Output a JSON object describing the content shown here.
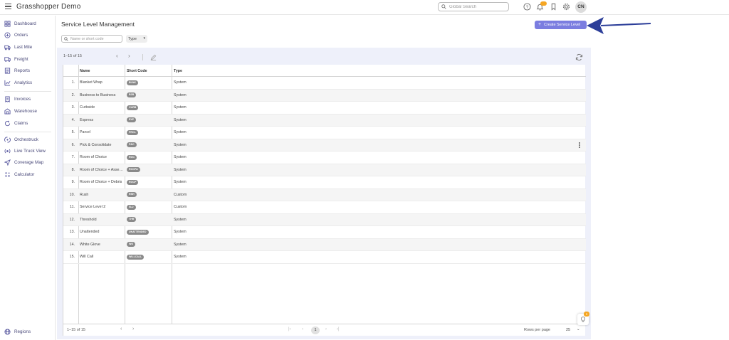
{
  "app": {
    "title": "Grasshopper Demo",
    "search_placeholder": "Global Search",
    "notification_count": "",
    "user_initials": "CN"
  },
  "sidebar": {
    "items": [
      {
        "label": "Dashboard",
        "icon": "dashboard-icon"
      },
      {
        "label": "Orders",
        "icon": "orders-icon"
      },
      {
        "label": "Last Mile",
        "icon": "last-mile-icon"
      },
      {
        "label": "Freight",
        "icon": "freight-icon"
      },
      {
        "label": "Reports",
        "icon": "reports-icon"
      },
      {
        "label": "Analytics",
        "icon": "analytics-icon"
      },
      {
        "label": "Invoices",
        "icon": "invoices-icon"
      },
      {
        "label": "Warehouse",
        "icon": "warehouse-icon"
      },
      {
        "label": "Claims",
        "icon": "claims-icon"
      },
      {
        "label": "Orchestruck",
        "icon": "orchestruck-icon"
      },
      {
        "label": "Live Truck View",
        "icon": "live-truck-icon"
      },
      {
        "label": "Coverage Map",
        "icon": "coverage-map-icon"
      },
      {
        "label": "Calculator",
        "icon": "calculator-icon"
      }
    ],
    "bottom_item": {
      "label": "Regions",
      "icon": "globe-icon"
    }
  },
  "page": {
    "title": "Service Level Management",
    "create_button": "Create Service Level",
    "filter_placeholder": "Name or short code",
    "type_filter": "Type",
    "range_top": "1–15 of 15",
    "range_bottom": "1–15 of 15",
    "current_page": "1",
    "rows_per_page_label": "Rows per page",
    "rows_per_page_value": "25"
  },
  "table": {
    "columns": [
      "Name",
      "Short Code",
      "Type"
    ],
    "rows": [
      {
        "n": "1.",
        "name": "Blanket Wrap",
        "code": "BLNK",
        "type": "System"
      },
      {
        "n": "2.",
        "name": "Business to Business",
        "code": "B2B",
        "type": "System"
      },
      {
        "n": "3.",
        "name": "Curbside",
        "code": "CURB",
        "type": "System"
      },
      {
        "n": "4.",
        "name": "Express",
        "code": "EXP",
        "type": "System"
      },
      {
        "n": "5.",
        "name": "Parcel",
        "code": "PRCL",
        "type": "System"
      },
      {
        "n": "6.",
        "name": "Pick & Consolidate",
        "code": "P&C",
        "type": "System"
      },
      {
        "n": "7.",
        "name": "Room of Choice",
        "code": "ROC",
        "type": "System"
      },
      {
        "n": "8.",
        "name": "Room of Choice + Assembly",
        "code": "ROCPA",
        "type": "System"
      },
      {
        "n": "9.",
        "name": "Room of Choice + Debris",
        "code": "ROCP",
        "type": "System"
      },
      {
        "n": "10.",
        "name": "Rush",
        "code": "RSH",
        "type": "Custom"
      },
      {
        "n": "11.",
        "name": "Service Level 2",
        "code": "SL2",
        "type": "Custom"
      },
      {
        "n": "12.",
        "name": "Threshold",
        "code": "THR",
        "type": "System"
      },
      {
        "n": "13.",
        "name": "Unattended",
        "code": "UNATTENDED",
        "type": "System"
      },
      {
        "n": "14.",
        "name": "White Glove",
        "code": "WG",
        "type": "System"
      },
      {
        "n": "15.",
        "name": "Will Call",
        "code": "WILLCALL",
        "type": "System"
      }
    ]
  },
  "help_badge": "1",
  "colors": {
    "accent": "#7b7de0",
    "arrow": "#2c3e99",
    "badge": "#f5a623",
    "chip": "#8a8a8a",
    "panel": "#eef0fa"
  }
}
